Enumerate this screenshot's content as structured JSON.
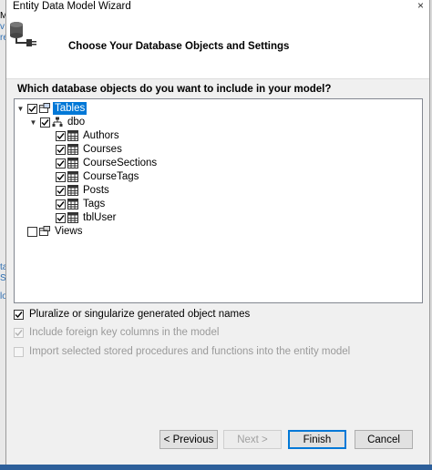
{
  "window": {
    "title": "Entity Data Model Wizard",
    "close_glyph": "×"
  },
  "background": {
    "fragments": [
      "M",
      "v",
      "re",
      "ta",
      "S",
      "lo"
    ]
  },
  "header": {
    "heading": "Choose Your Database Objects and Settings"
  },
  "question": "Which database objects do you want to include in your model?",
  "tree": {
    "root": {
      "label": "Tables",
      "checked": true,
      "selected": true
    },
    "schema": {
      "label": "dbo",
      "checked": true
    },
    "tables": [
      "Authors",
      "Courses",
      "CourseSections",
      "CourseTags",
      "Posts",
      "Tags",
      "tblUser"
    ],
    "views": {
      "label": "Views",
      "checked": false
    }
  },
  "options": {
    "pluralize": "Pluralize or singularize generated object names",
    "foreign_keys": "Include foreign key columns in the model",
    "import_procs": "Import selected stored procedures and functions into the entity model"
  },
  "buttons": {
    "previous": "< Previous",
    "next": "Next >",
    "finish": "Finish",
    "cancel": "Cancel"
  },
  "colors": {
    "selection": "#0078d7",
    "bottom_bar": "#2d5f9a"
  }
}
